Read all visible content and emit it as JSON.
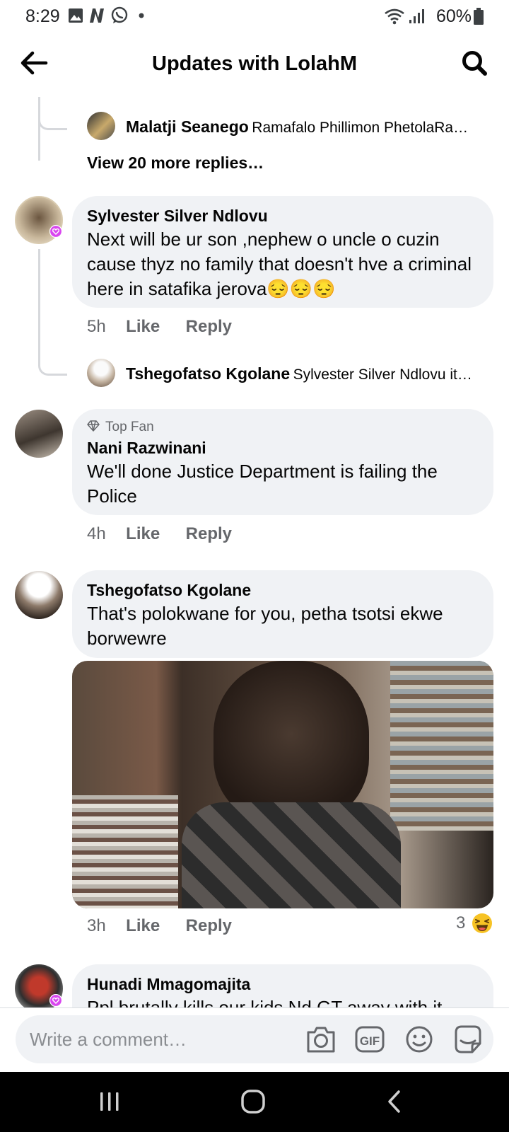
{
  "status_bar": {
    "time": "8:29",
    "battery": "60%"
  },
  "header": {
    "title": "Updates with LolahM"
  },
  "thread": {
    "top_reply": {
      "author": "Malatji Seanego",
      "preview": "Ramafalo Phillimon PhetolaRa…"
    },
    "view_more": "View 20 more replies…"
  },
  "comments": [
    {
      "author": "Sylvester Silver Ndlovu",
      "text": "Next will be ur son ,nephew o uncle o cuzin cause thyz no family that doesn't hve a criminal here in satafika jerova😔😔😔",
      "time": "5h",
      "like": "Like",
      "reply": "Reply",
      "nested_reply": {
        "author": "Tshegofatso Kgolane",
        "preview": "Sylvester Silver Ndlovu it…"
      }
    },
    {
      "badge": "Top Fan",
      "author": "Nani Razwinani",
      "text": "We'll done Justice Department is failing the Police",
      "time": "4h",
      "like": "Like",
      "reply": "Reply"
    },
    {
      "author": "Tshegofatso Kgolane",
      "text": "That's polokwane for you, petha tsotsi ekwe borwewre",
      "time": "3h",
      "like": "Like",
      "reply": "Reply",
      "reaction_count": "3",
      "reaction_icon": "laughing-emoji"
    },
    {
      "author": "Hunadi Mmagomajita",
      "text": "Ppl brutally kills our kids Nd GT away with it"
    }
  ],
  "composer": {
    "placeholder": "Write a comment…"
  },
  "colors": {
    "bubble": "#f0f2f5",
    "meta": "#65676b",
    "thread_line": "#d6d8dc",
    "accent_badge": "#d946ef"
  }
}
